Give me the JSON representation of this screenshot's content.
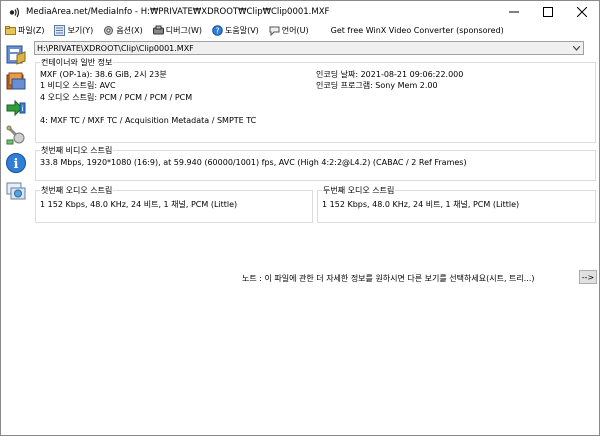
{
  "window": {
    "title": "MediaArea.net/MediaInfo - H:₩PRIVATE₩XDROOT₩Clip₩Clip0001.MXF"
  },
  "menu": {
    "items": [
      {
        "label": "파일(Z)",
        "icon": "folder-icon"
      },
      {
        "label": "보기(Y)",
        "icon": "view-icon"
      },
      {
        "label": "옵션(X)",
        "icon": "options-icon"
      },
      {
        "label": "디버그(W)",
        "icon": "debug-icon"
      },
      {
        "label": "도움말(V)",
        "icon": "help-icon"
      },
      {
        "label": "언어(U)",
        "icon": "language-icon"
      }
    ],
    "sponsor": "Get free WinX Video Converter (sponsored)"
  },
  "file_select": {
    "value": "H:\\PRIVATE\\XDROOT\\Clip\\Clip0001.MXF"
  },
  "general": {
    "legend": "컨테이너와 일반 정보",
    "left_lines": [
      "MXF (OP-1a): 38.6 GiB, 2시 23분",
      "1 비디오 스트림: AVC",
      "4 오디오 스트림: PCM / PCM / PCM / PCM",
      "",
      "4: MXF TC / MXF TC / Acquisition Metadata / SMPTE TC"
    ],
    "right_lines": [
      "인코딩 날짜: 2021-08-21 09:06:22.000",
      "인코딩 프로그램: Sony Mem 2.00"
    ]
  },
  "video": {
    "legend": "첫번째 비디오 스트림",
    "line": "33.8 Mbps, 1920*1080 (16:9), at 59.940 (60000/1001) fps, AVC (High 4:2:2@L4.2) (CABAC / 2 Ref Frames)"
  },
  "audio1": {
    "legend": "첫번째 오디오 스트림",
    "line": "1 152 Kbps, 48.0 KHz, 24 비트, 1 채널, PCM (Little)"
  },
  "audio2": {
    "legend": "두번째 오디오 스트림",
    "line": "1 152 Kbps, 48.0 KHz, 24 비트, 1 채널, PCM (Little)"
  },
  "note": {
    "text": "노트 : 이 파일에 관한 더 자세한 정보를 원하시면 다른 보기를 선택하세요(시트, 트리...)",
    "button": "-->"
  },
  "colors": {
    "accent": "#0078d7",
    "border": "#dcdcdc"
  }
}
